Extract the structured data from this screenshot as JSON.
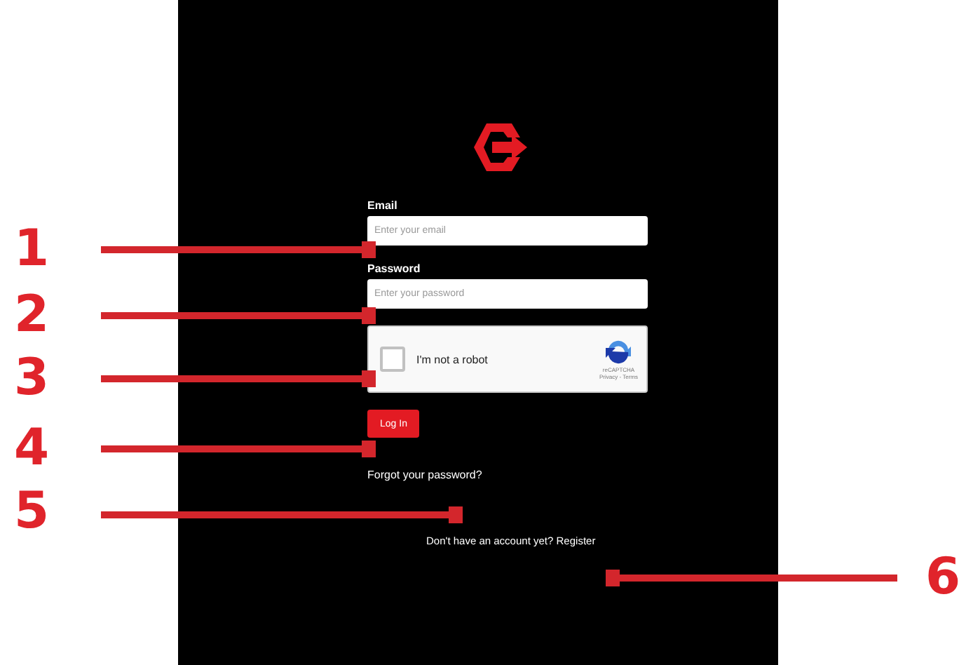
{
  "login": {
    "email": {
      "label": "Email",
      "placeholder": "Enter your email"
    },
    "password": {
      "label": "Password",
      "placeholder": "Enter your password"
    },
    "captcha": {
      "label": "I'm not a robot",
      "checked": false,
      "brand": "reCAPTCHA",
      "links": "Privacy - Terms"
    },
    "button": "Log In",
    "forgot": "Forgot your password?",
    "register": {
      "prompt": "Don't have an account yet?",
      "link": "Register"
    }
  },
  "callouts": [
    {
      "number": "1"
    },
    {
      "number": "2"
    },
    {
      "number": "3"
    },
    {
      "number": "4"
    },
    {
      "number": "5"
    },
    {
      "number": "6"
    }
  ]
}
